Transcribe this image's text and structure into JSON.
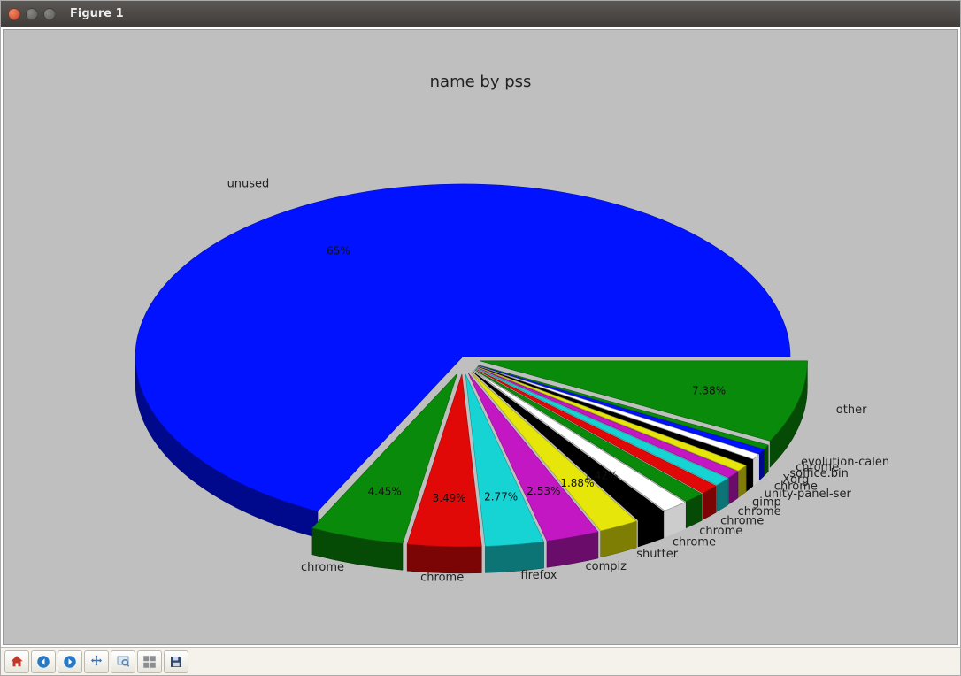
{
  "window": {
    "title": "Figure 1"
  },
  "chart_data": {
    "type": "pie",
    "title": "name by pss",
    "series": [
      {
        "name": "unused",
        "value": 65.0,
        "color": "#0012ff",
        "exploded": false
      },
      {
        "name": "chrome",
        "value": 4.45,
        "color": "#0a8a0a",
        "exploded": true
      },
      {
        "name": "chrome",
        "value": 3.49,
        "color": "#e10808",
        "exploded": true
      },
      {
        "name": "firefox",
        "value": 2.77,
        "color": "#16d4d4",
        "exploded": true
      },
      {
        "name": "compiz",
        "value": 2.53,
        "color": "#c217c2",
        "exploded": true
      },
      {
        "name": "shutter",
        "value": 1.88,
        "color": "#e6e60a",
        "exploded": true
      },
      {
        "name": "chrome",
        "value": 1.42,
        "color": "#000000",
        "exploded": true
      },
      {
        "name": "chrome",
        "value": 1.2,
        "color": "#ffffff",
        "exploded": true
      },
      {
        "name": "chrome",
        "value": 1.0,
        "color": "#0a8a0a",
        "exploded": true
      },
      {
        "name": "chrome",
        "value": 0.9,
        "color": "#e10808",
        "exploded": true
      },
      {
        "name": "gimp",
        "value": 0.8,
        "color": "#16d4d4",
        "exploded": true
      },
      {
        "name": "unity-panel-ser",
        "value": 0.7,
        "color": "#c217c2",
        "exploded": true
      },
      {
        "name": "chrome",
        "value": 0.6,
        "color": "#e6e60a",
        "exploded": true
      },
      {
        "name": "Xorg",
        "value": 0.55,
        "color": "#000000",
        "exploded": true
      },
      {
        "name": "soffice.bin",
        "value": 0.5,
        "color": "#ffffff",
        "exploded": true
      },
      {
        "name": "chrome",
        "value": 0.45,
        "color": "#0012ff",
        "exploded": true
      },
      {
        "name": "evolution-calen",
        "value": 0.4,
        "color": "#0a8a0a",
        "exploded": true
      },
      {
        "name": "other",
        "value": 7.38,
        "color": "#0a8a0a",
        "exploded": true
      }
    ]
  },
  "toolbar": {
    "home": "Home",
    "back": "Back",
    "forward": "Forward",
    "pan": "Pan",
    "zoom": "Zoom",
    "subplots": "Configure subplots",
    "save": "Save"
  }
}
